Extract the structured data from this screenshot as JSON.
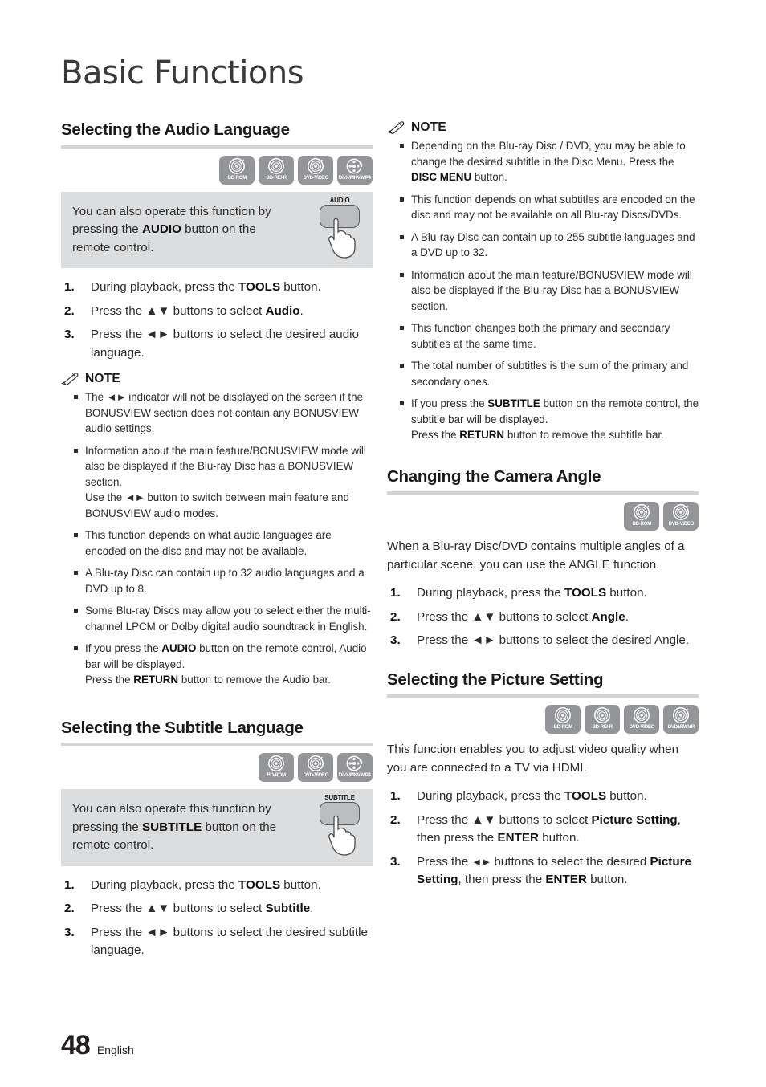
{
  "page": {
    "chapter_title": "Basic Functions",
    "page_number": "48",
    "language": "English"
  },
  "icons": {
    "note_icon": "pencil-icon",
    "disc_glyph": "disc-icon",
    "film_glyph": "film-reel-icon",
    "hand_glyph": "pressing-hand-icon"
  },
  "labels": {
    "note": "NOTE",
    "bd_rom": "BD-ROM",
    "bd_re_r": "BD-RE/-R",
    "dvd_video": "DVD-VIDEO",
    "divx": "DivX/MKV/MP4",
    "dvd_rw_r": "DVD±RW/±R"
  },
  "sections": {
    "audio": {
      "heading": "Selecting the Audio Language",
      "discs": [
        "BD-ROM",
        "BD-RE/-R",
        "DVD-VIDEO",
        "DivX/MKV/MP4"
      ],
      "callout": {
        "text_1": "You can also operate this function by pressing the ",
        "bold": "AUDIO",
        "text_2": " button on the remote control.",
        "remote_button": "AUDIO"
      },
      "steps": [
        {
          "num": "1.",
          "t1": "During playback, press the ",
          "b": "TOOLS",
          "t2": " button."
        },
        {
          "num": "2.",
          "t1": "Press the ▲▼ buttons to select ",
          "b": "Audio",
          "t2": "."
        },
        {
          "num": "3.",
          "t1": "Press the ◄► buttons to select the desired audio language.",
          "b": "",
          "t2": ""
        }
      ],
      "notes": [
        "The ◄► indicator will not be displayed on the screen if the BONUSVIEW section does not contain any BONUSVIEW audio settings.",
        "Information about the main feature/BONUSVIEW mode will also be displayed if the Blu-ray Disc has a BONUSVIEW section.\nUse the ◄► button to switch between main feature and BONUSVIEW audio modes.",
        "This function depends on what audio languages are encoded on the disc and may not be available.",
        "A Blu-ray Disc can contain up to 32 audio languages and a DVD up to 8.",
        "Some Blu-ray Discs may allow you to select either the multi-channel LPCM or Dolby digital audio soundtrack in English.",
        "If you press the AUDIO button on the remote control, Audio bar will be displayed.\nPress the RETURN button to remove the Audio bar."
      ]
    },
    "subtitle": {
      "heading": "Selecting the Subtitle Language",
      "discs": [
        "BD-ROM",
        "DVD-VIDEO",
        "DivX/MKV/MP4"
      ],
      "callout": {
        "text_1": "You can also operate this function by pressing the ",
        "bold": "SUBTITLE",
        "text_2": " button on the remote control.",
        "remote_button": "SUBTITLE"
      },
      "steps": [
        {
          "num": "1.",
          "t1": "During playback, press the ",
          "b": "TOOLS",
          "t2": " button."
        },
        {
          "num": "2.",
          "t1": "Press the ▲▼ buttons to select ",
          "b": "Subtitle",
          "t2": "."
        },
        {
          "num": "3.",
          "t1": "Press the ◄► buttons to select the desired subtitle language.",
          "b": "",
          "t2": ""
        }
      ],
      "notes": [
        "Depending on the Blu-ray Disc / DVD, you may be able to change the desired subtitle in the Disc Menu. Press the DISC MENU button.",
        "This function depends on what subtitles are encoded on the disc and may not be available on all Blu-ray Discs/DVDs.",
        "A Blu-ray Disc can contain up to 255 subtitle languages and a DVD up to 32.",
        "Information about the main feature/BONUSVIEW mode will also be displayed if the Blu-ray Disc has a BONUSVIEW section.",
        "This function changes both the primary and secondary subtitles at the same time.",
        "The total number of subtitles is the sum of the primary and secondary ones.",
        "If you press the SUBTITLE button on the remote control, the subtitle bar will be displayed.\nPress the RETURN button to remove the subtitle bar."
      ]
    },
    "angle": {
      "heading": "Changing the Camera Angle",
      "discs": [
        "BD-ROM",
        "DVD-VIDEO"
      ],
      "intro": "When a Blu-ray Disc/DVD contains multiple angles of a particular scene, you can use the ANGLE function.",
      "steps": [
        {
          "num": "1.",
          "t1": "During playback, press the ",
          "b": "TOOLS",
          "t2": " button."
        },
        {
          "num": "2.",
          "t1": "Press the ▲▼ buttons to select ",
          "b": "Angle",
          "t2": "."
        },
        {
          "num": "3.",
          "t1": "Press the ◄► buttons to select the desired Angle.",
          "b": "",
          "t2": ""
        }
      ]
    },
    "picture": {
      "heading": "Selecting the Picture Setting",
      "discs": [
        "BD-ROM",
        "BD-RE/-R",
        "DVD-VIDEO",
        "DVD±RW/±R"
      ],
      "intro": "This function enables you to adjust video quality when you are connected to a TV via HDMI.",
      "steps": [
        {
          "num": "1.",
          "t1": "During playback, press the ",
          "b": "TOOLS",
          "t2": " button."
        },
        {
          "num": "2.",
          "t1": "Press the ▲▼ buttons to select ",
          "b": "Picture Setting",
          "t2": ", then press the ENTER button."
        },
        {
          "num": "3.",
          "t1": "Press the ◄► buttons to select the desired Picture Setting, then press the ENTER button.",
          "b": "",
          "t2": ""
        }
      ]
    }
  },
  "colors": {
    "rule": "#d2d3d5",
    "callout_bg": "#dcdddf",
    "disc_bg": "#939598",
    "text": "#2c2c2c"
  }
}
